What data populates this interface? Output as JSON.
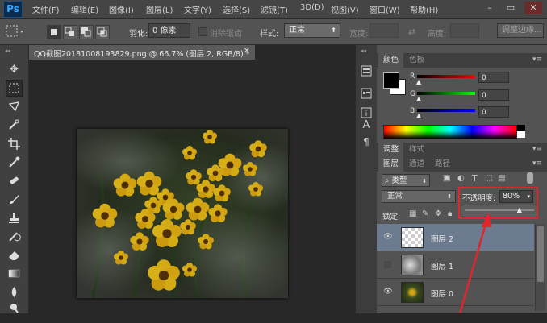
{
  "app": {
    "logo": "Ps",
    "menu": [
      "文件(F)",
      "编辑(E)",
      "图像(I)",
      "图层(L)",
      "文字(Y)",
      "选择(S)",
      "滤镜(T)",
      "3D(D)",
      "视图(V)",
      "窗口(W)",
      "帮助(H)"
    ],
    "window_buttons": {
      "minimize": "–",
      "restore": "▭",
      "close": "✕"
    }
  },
  "options_bar": {
    "feather_label": "羽化:",
    "feather_value": "0 像素",
    "antialias_label": "消除锯齿",
    "style_label": "样式:",
    "style_value": "正常",
    "width_label": "宽度:",
    "height_label": "高度:",
    "refine_edge_label": "调整边缘..."
  },
  "document": {
    "tab_label": "QQ截图20181008193829.png @ 66.7% (图层 2, RGB/8) *",
    "close_glyph": "✕"
  },
  "color_panel": {
    "tabs": [
      "颜色",
      "色板"
    ],
    "channels": [
      {
        "label": "R",
        "value": "0"
      },
      {
        "label": "G",
        "value": "0"
      },
      {
        "label": "B",
        "value": "0"
      }
    ]
  },
  "adjust_panel": {
    "tabs": [
      "调整",
      "样式"
    ]
  },
  "layers_panel": {
    "tabs": [
      "图层",
      "通道",
      "路径"
    ],
    "filter_value": "类型",
    "blend_mode": "正常",
    "opacity_label": "不透明度:",
    "opacity_value": "80%",
    "opacity_fraction": 0.8,
    "lock_label": "锁定:",
    "layers": [
      {
        "name": "图层 2",
        "visible": true,
        "selected": true
      },
      {
        "name": "图层 1",
        "visible": false,
        "selected": false
      },
      {
        "name": "图层 0",
        "visible": true,
        "selected": false
      }
    ]
  },
  "colors": {
    "annotation_red": "#e0262d",
    "selected_layer": "#6c7b90"
  },
  "icons": [
    "marquee-icon",
    "move-icon",
    "lasso-icon",
    "quick-select-icon",
    "crop-icon",
    "eyedropper-icon",
    "healing-brush-icon",
    "brush-icon",
    "clone-stamp-icon",
    "history-brush-icon",
    "eraser-icon",
    "gradient-icon",
    "blur-icon",
    "dodge-icon",
    "eye-icon",
    "link-icon"
  ]
}
